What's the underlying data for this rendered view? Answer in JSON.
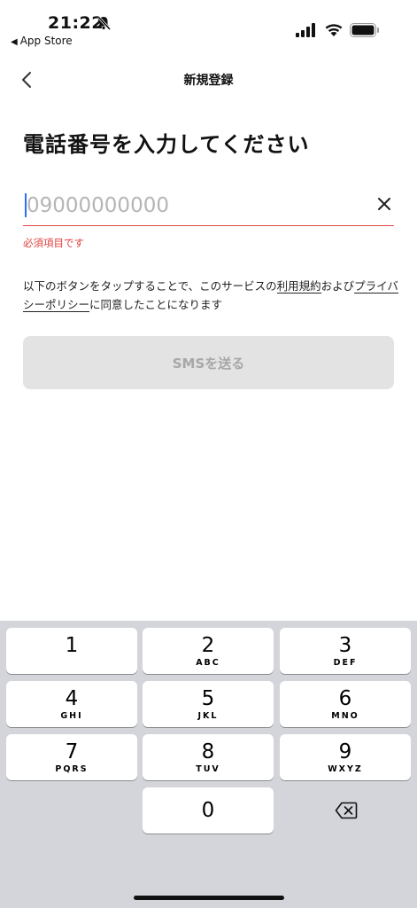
{
  "status_bar": {
    "time": "21:22",
    "back_app": "App Store",
    "icons": [
      "bell-slash-icon",
      "signal-icon",
      "wifi-icon",
      "battery-icon"
    ]
  },
  "nav": {
    "title": "新規登録",
    "back_icon": "chevron-left-icon"
  },
  "page": {
    "title": "電話番号を入力してください",
    "phone_placeholder": "09000000000",
    "phone_value": "",
    "error": "必須項目です",
    "terms_before": "以下のボタンをタップすることで、このサービスの",
    "terms_link": "利用規約",
    "terms_middle": "および",
    "privacy_link": "プライバシーポリシー",
    "terms_after": "に同意したことになります",
    "submit_label": "SMSを送る"
  },
  "keyboard": {
    "keys": [
      {
        "digit": "1",
        "letters": ""
      },
      {
        "digit": "2",
        "letters": "ABC"
      },
      {
        "digit": "3",
        "letters": "DEF"
      },
      {
        "digit": "4",
        "letters": "GHI"
      },
      {
        "digit": "5",
        "letters": "JKL"
      },
      {
        "digit": "6",
        "letters": "MNO"
      },
      {
        "digit": "7",
        "letters": "PQRS"
      },
      {
        "digit": "8",
        "letters": "TUV"
      },
      {
        "digit": "9",
        "letters": "WXYZ"
      },
      {
        "digit": "0",
        "letters": ""
      }
    ],
    "delete_icon": "backspace-icon"
  },
  "colors": {
    "error": "#e03f3f",
    "button_disabled_bg": "#e3e3e3",
    "button_disabled_text": "#a7a7a7",
    "keyboard_bg": "#d3d5db"
  }
}
